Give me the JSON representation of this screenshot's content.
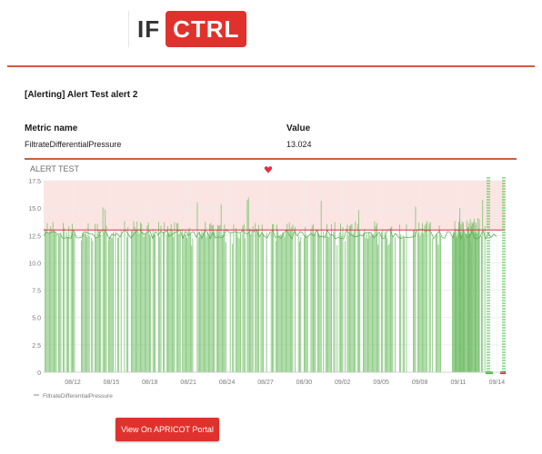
{
  "logo": {
    "left": "IF",
    "right": "CTRL"
  },
  "email": {
    "subject": "[Alerting] Alert Test alert 2"
  },
  "metrics_table": {
    "headers": {
      "name": "Metric name",
      "value": "Value"
    },
    "rows": [
      {
        "name": "FiltrateDifferentialPressure",
        "value": "13.024"
      }
    ]
  },
  "button": {
    "label": "View On APRICOT Portal"
  },
  "colors": {
    "brand_red": "#e0322d",
    "series_green": "#73bf69",
    "threshold_fill": "#fbe5e3",
    "threshold_line": "#e02f44"
  },
  "chart_data": {
    "type": "bar",
    "title": "ALERT TEST",
    "status_icon": "broken-heart-icon",
    "ylim": [
      0,
      17.5
    ],
    "yticks": [
      "0",
      "2.5",
      "5.0",
      "7.5",
      "10.0",
      "12.5",
      "15.0",
      "17.5"
    ],
    "xticks": [
      "08/12",
      "08/15",
      "08/18",
      "08/21",
      "08/24",
      "08/27",
      "08/30",
      "09/02",
      "09/05",
      "09/08",
      "09/11",
      "09/14"
    ],
    "threshold": {
      "value": 13,
      "op": "gt",
      "region": [
        13,
        17.5
      ]
    },
    "series": [
      {
        "name": "FiltrateDifferentialPressure",
        "typical_value": 13.024,
        "range": [
          0,
          16
        ]
      }
    ],
    "grid": true,
    "legend": "bottom-left"
  }
}
